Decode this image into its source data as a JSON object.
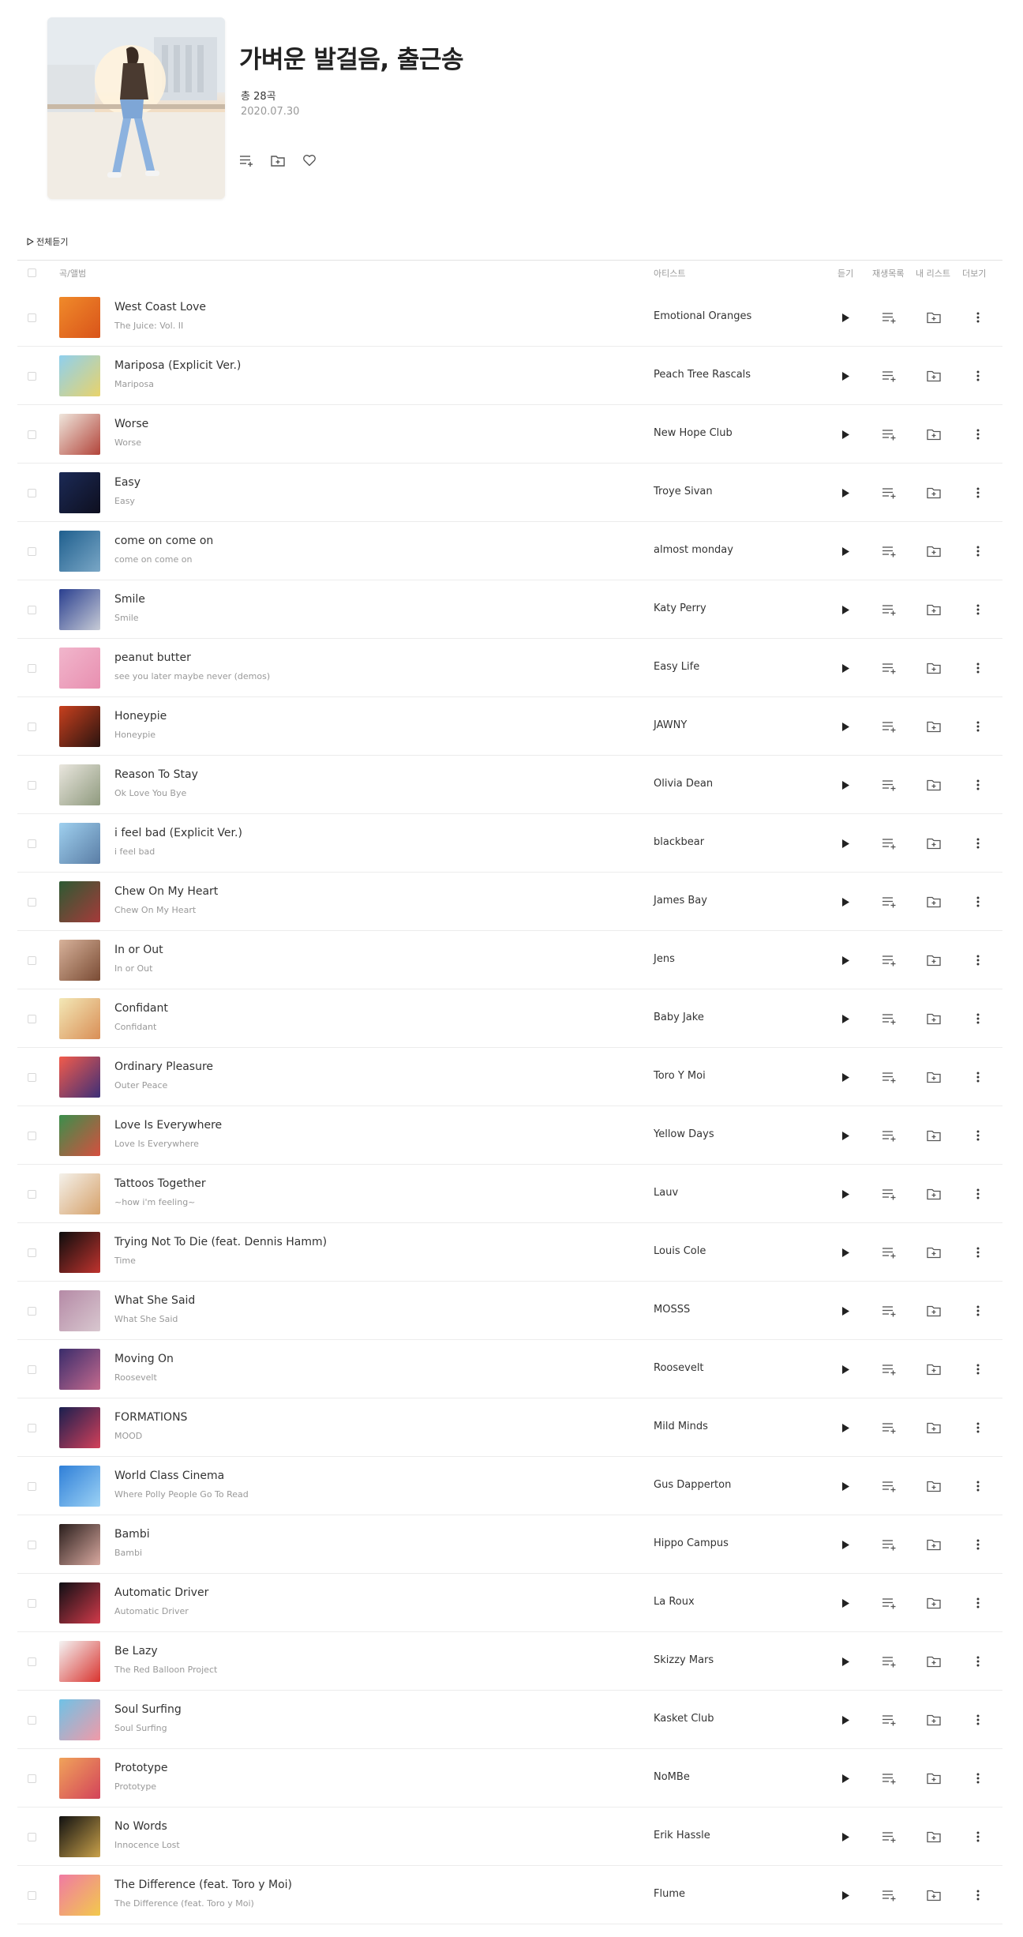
{
  "playlist": {
    "title": "가벼운 발걸음, 출근송",
    "count_label": "총 28곡",
    "date": "2020.07.30",
    "actions": [
      "playlist-add-icon",
      "folder-add-icon",
      "heart-icon"
    ]
  },
  "play_all_label": "전체듣기",
  "columns": {
    "song_album": "곡/앨범",
    "artist": "아티스트",
    "listen": "듣기",
    "add_to_playlist": "재생목록",
    "my_list": "내 리스트",
    "more": "더보기"
  },
  "colors": {
    "text": "#333333",
    "muted": "#999999",
    "divider": "#ececec"
  },
  "tracks": [
    {
      "title": "West Coast Love",
      "album": "The Juice: Vol. II",
      "artist": "Emotional Oranges",
      "thumb": [
        "#f08a2a",
        "#d9541a"
      ]
    },
    {
      "title": "Mariposa (Explicit Ver.)",
      "album": "Mariposa",
      "artist": "Peach Tree Rascals",
      "thumb": [
        "#8fd0ee",
        "#e8d36b"
      ]
    },
    {
      "title": "Worse",
      "album": "Worse",
      "artist": "New Hope Club",
      "thumb": [
        "#efe6dc",
        "#b2443a"
      ]
    },
    {
      "title": "Easy",
      "album": "Easy",
      "artist": "Troye Sivan",
      "thumb": [
        "#1b2a56",
        "#0e0f1f"
      ]
    },
    {
      "title": "come on come on",
      "album": "come on come on",
      "artist": "almost monday",
      "thumb": [
        "#1f5f8e",
        "#7aa7c6"
      ]
    },
    {
      "title": "Smile",
      "album": "Smile",
      "artist": "Katy Perry",
      "thumb": [
        "#2a3f8f",
        "#c7cbd6"
      ]
    },
    {
      "title": "peanut butter",
      "album": "see you later maybe never (demos)",
      "artist": "Easy Life",
      "thumb": [
        "#f1b6cc",
        "#e88fb0"
      ]
    },
    {
      "title": "Honeypie",
      "album": "Honeypie",
      "artist": "JAWNY",
      "thumb": [
        "#c8401e",
        "#2a1410"
      ]
    },
    {
      "title": "Reason To Stay",
      "album": "Ok Love You Bye",
      "artist": "Olivia Dean",
      "thumb": [
        "#e9e6de",
        "#8f9a7e"
      ]
    },
    {
      "title": "i feel bad (Explicit Ver.)",
      "album": "i feel bad",
      "artist": "blackbear",
      "thumb": [
        "#9fd0ef",
        "#5a7da5"
      ]
    },
    {
      "title": "Chew On My Heart",
      "album": "Chew On My Heart",
      "artist": "James Bay",
      "thumb": [
        "#2d5a33",
        "#a63a3a"
      ]
    },
    {
      "title": "In or Out",
      "album": "In or Out",
      "artist": "Jens",
      "thumb": [
        "#d7b29a",
        "#7a4b34"
      ]
    },
    {
      "title": "Confidant",
      "album": "Confidant",
      "artist": "Baby Jake",
      "thumb": [
        "#f3e8b6",
        "#d98e56"
      ]
    },
    {
      "title": "Ordinary Pleasure",
      "album": "Outer Peace",
      "artist": "Toro Y Moi",
      "thumb": [
        "#f25b4b",
        "#3d2f78"
      ]
    },
    {
      "title": "Love Is Everywhere",
      "album": "Love Is Everywhere",
      "artist": "Yellow Days",
      "thumb": [
        "#3b8f4c",
        "#d64f3f"
      ]
    },
    {
      "title": "Tattoos Together",
      "album": "~how i'm feeling~",
      "artist": "Lauv",
      "thumb": [
        "#f4f1ea",
        "#d6a16a"
      ]
    },
    {
      "title": "Trying Not To Die (feat. Dennis Hamm)",
      "album": "Time",
      "artist": "Louis Cole",
      "thumb": [
        "#0d0d0d",
        "#c0332e"
      ]
    },
    {
      "title": "What She Said",
      "album": "What She Said",
      "artist": "MOSSS",
      "thumb": [
        "#b58aa6",
        "#d8c7cf"
      ]
    },
    {
      "title": "Moving On",
      "album": "Roosevelt",
      "artist": "Roosevelt",
      "thumb": [
        "#3a2c6b",
        "#c46a8e"
      ]
    },
    {
      "title": "FORMATIONS",
      "album": "MOOD",
      "artist": "Mild Minds",
      "thumb": [
        "#1a1f4f",
        "#d3405a"
      ]
    },
    {
      "title": "World Class Cinema",
      "album": "Where Polly People Go To Read",
      "artist": "Gus Dapperton",
      "thumb": [
        "#2f7fd8",
        "#9cd2f5"
      ]
    },
    {
      "title": "Bambi",
      "album": "Bambi",
      "artist": "Hippo Campus",
      "thumb": [
        "#2a1e1c",
        "#d9a9a0"
      ]
    },
    {
      "title": "Automatic Driver",
      "album": "Automatic Driver",
      "artist": "La Roux",
      "thumb": [
        "#0f0f14",
        "#d23a4a"
      ]
    },
    {
      "title": "Be Lazy",
      "album": "The Red Balloon Project",
      "artist": "Skizzy Mars",
      "thumb": [
        "#f4f4f4",
        "#d9342f"
      ]
    },
    {
      "title": "Soul Surfing",
      "album": "Soul Surfing",
      "artist": "Kasket Club",
      "thumb": [
        "#6fc2e6",
        "#f19aa8"
      ]
    },
    {
      "title": "Prototype",
      "album": "Prototype",
      "artist": "NoMBe",
      "thumb": [
        "#f0a35a",
        "#d3435a"
      ]
    },
    {
      "title": "No Words",
      "album": "Innocence Lost",
      "artist": "Erik Hassle",
      "thumb": [
        "#111111",
        "#c9a14a"
      ]
    },
    {
      "title": "The Difference (feat. Toro y Moi)",
      "album": "The Difference (feat. Toro y Moi)",
      "artist": "Flume",
      "thumb": [
        "#f07aa3",
        "#f2c94c"
      ]
    }
  ]
}
